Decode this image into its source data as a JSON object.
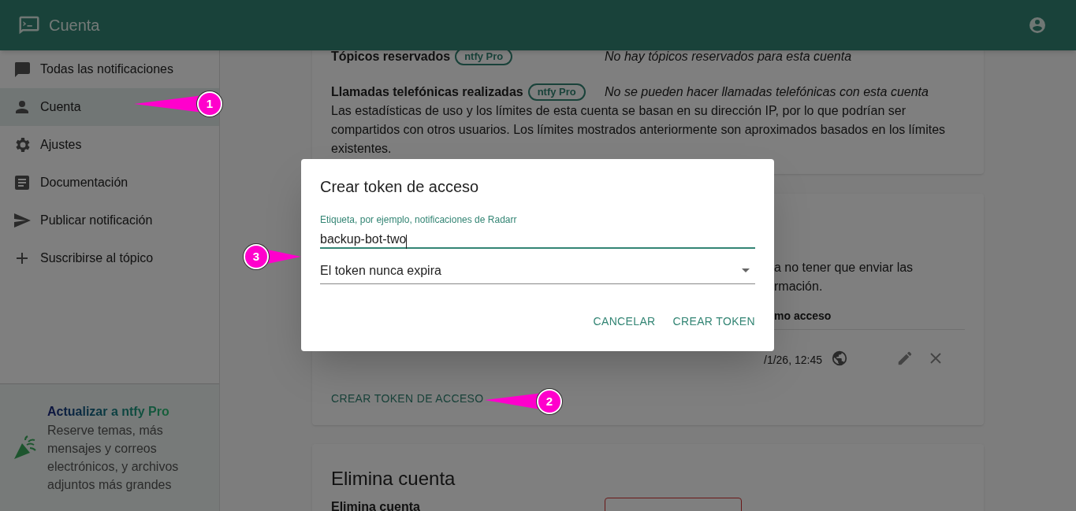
{
  "app_bar": {
    "title": "Cuenta"
  },
  "sidebar": {
    "items": [
      {
        "label": "Todas las notificaciones",
        "selected": false
      },
      {
        "label": "Cuenta",
        "selected": true
      },
      {
        "label": "Ajustes",
        "selected": false
      },
      {
        "label": "Documentación",
        "selected": false
      },
      {
        "label": "Publicar notificación",
        "selected": false
      },
      {
        "label": "Suscribirse al tópico",
        "selected": false
      }
    ],
    "promo": {
      "title": "Actualizar a ntfy Pro",
      "text": "Reserve temas, más mensajes y correos electrónicos, y archivos adjuntos más grandes"
    }
  },
  "usage_card": {
    "rows": [
      {
        "label": "Tópicos reservados",
        "badge": "ntfy Pro",
        "value": "No hay tópicos reservados para esta cuenta"
      },
      {
        "label": "Llamadas telefónicas realizadas",
        "badge": "ntfy Pro",
        "value": "No se pueden hacer llamadas telefónicas con esta cuenta"
      }
    ],
    "note": "Las estadísticas de uso y los límites de esta cuenta se basan en su dirección IP, por lo que podrían ser compartidos con otros usuarios. Los límites mostrados anteriormente son aproximados basados en los límites existentes."
  },
  "tokens_card": {
    "text_fragments": [
      "a no tener que enviar las",
      "rmación."
    ],
    "column_fragment": "mo acceso",
    "row": {
      "last_access": "/1/26, 12:45"
    },
    "create_button": "CREAR TOKEN DE ACCESO"
  },
  "delete_card": {
    "title": "Elimina cuenta",
    "row_label": "Elimina cuenta"
  },
  "dialog": {
    "title": "Crear token de acceso",
    "label_field": {
      "label": "Etiqueta, por ejemplo, notificaciones de Radarr",
      "value": "backup-bot-two"
    },
    "expiry_select": {
      "value": "El token nunca expira"
    },
    "buttons": [
      "CANCELAR",
      "CREAR TOKEN"
    ]
  },
  "callouts": [
    {
      "number": "1"
    },
    {
      "number": "2"
    },
    {
      "number": "3"
    }
  ]
}
